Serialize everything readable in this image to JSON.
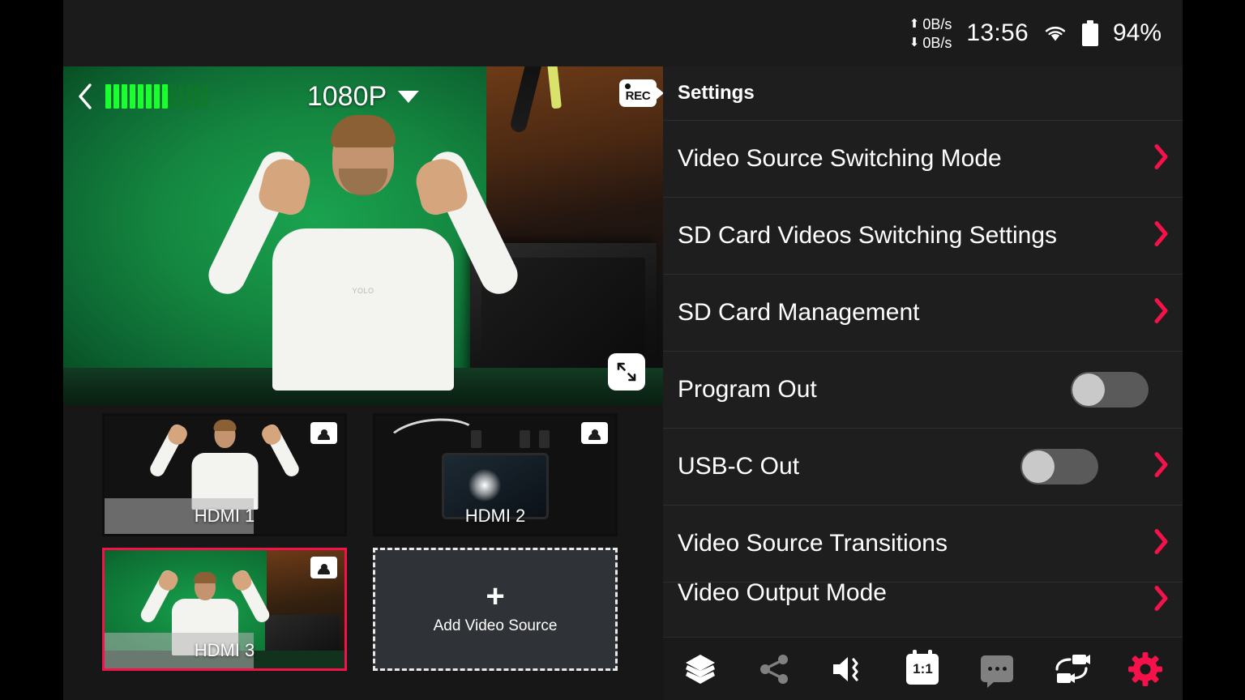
{
  "status_bar": {
    "upload_rate": "0B/s",
    "download_rate": "0B/s",
    "upload_arrow": "⬆",
    "download_arrow": "⬇",
    "clock": "13:56",
    "wifi_icon": "wifi-icon",
    "battery_icon": "battery-icon",
    "battery_percent": "94%"
  },
  "preview": {
    "back_icon": "back-chevron-icon",
    "resolution": "1080P",
    "dropdown_icon": "chevron-down-icon",
    "rec_badge": {
      "icon": "record-camera-icon",
      "label": "REC"
    },
    "expand_icon": "expand-fullscreen-icon",
    "audio_meter": {
      "name": "audio-level-meter",
      "active_bars": 8,
      "total_bars": 13,
      "active_color": "#1aff2e",
      "inactive_color": "#0f7a22"
    }
  },
  "sources": {
    "thumbnails": [
      {
        "label": "HDMI 1",
        "selected": false,
        "badge_icon": "person-badge-icon",
        "art": "art-dark"
      },
      {
        "label": "HDMI 2",
        "selected": false,
        "badge_icon": "person-badge-icon",
        "art": "art-gear"
      },
      {
        "label": "HDMI 3",
        "selected": true,
        "badge_icon": "person-badge-icon",
        "art": "art-green"
      }
    ],
    "add_source": {
      "plus_icon": "plus-icon",
      "label": "Add Video Source"
    },
    "selected_color": "#f5124b"
  },
  "settings": {
    "title": "Settings",
    "accent_color": "#f5124b",
    "rows": [
      {
        "label": "Video Source Switching Mode",
        "type": "link",
        "chevron": true,
        "toggle": false
      },
      {
        "label": "SD Card Videos Switching Settings",
        "type": "link",
        "chevron": true,
        "toggle": false
      },
      {
        "label": "SD Card Management",
        "type": "link",
        "chevron": true,
        "toggle": false
      },
      {
        "label": "Program Out",
        "type": "toggle",
        "chevron": false,
        "toggle": true,
        "toggle_on": false
      },
      {
        "label": "USB-C Out",
        "type": "toggle-link",
        "chevron": true,
        "toggle": true,
        "toggle_on": false
      },
      {
        "label": "Video Source Transitions",
        "type": "link",
        "chevron": true,
        "toggle": false
      },
      {
        "label": "Video Output Mode",
        "type": "link",
        "chevron": true,
        "toggle": false
      }
    ]
  },
  "toolbar": {
    "buttons": [
      {
        "name": "layers-icon",
        "icon": "layers",
        "color": "#ffffff"
      },
      {
        "name": "share-icon",
        "icon": "share",
        "color": "#808080"
      },
      {
        "name": "volume-icon",
        "icon": "volume",
        "color": "#ffffff"
      },
      {
        "name": "aspect-ratio-icon",
        "icon": "ratio-1-1",
        "color": "#ffffff",
        "label": "1:1"
      },
      {
        "name": "chat-icon",
        "icon": "chat",
        "color": "#808080"
      },
      {
        "name": "camera-switch-icon",
        "icon": "camera-switch",
        "color": "#ffffff"
      },
      {
        "name": "settings-gear-icon",
        "icon": "gear",
        "color": "#f5124b"
      }
    ]
  }
}
